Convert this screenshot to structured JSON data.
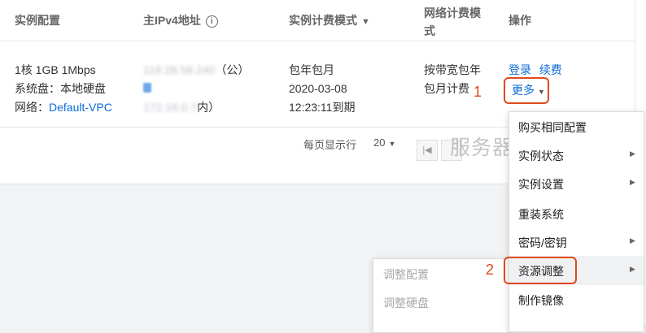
{
  "header": {
    "col_config": "实例配置",
    "col_ip": "主IPv4地址",
    "col_billing": "实例计费模式",
    "col_network_billing_1": "网络计费模",
    "col_network_billing_2": "式",
    "col_actions": "操作"
  },
  "row": {
    "config_line1": "1核 1GB 1Mbps",
    "config_line2": "系统盘：本地硬盘",
    "config_network_label": "网络：",
    "config_network_value": "Default-VPC",
    "ip_public_value": "119.28.58.240",
    "ip_public_suffix": "（公）",
    "ip_private_value": "172.16.0.7",
    "ip_private_suffix": "内）",
    "billing_mode": "包年包月",
    "billing_date": "2020-03-08",
    "billing_expire": "12:23:11到期",
    "network_billing_1": "按带宽包年",
    "network_billing_2": "包月计费",
    "action_login": "登录",
    "action_renew": "续费",
    "action_more": "更多"
  },
  "pager": {
    "per_page_label": "每页显示行",
    "per_page_value": "20"
  },
  "watermark": "服务器百科",
  "marks": {
    "mark1": "1",
    "mark2": "2"
  },
  "menu": {
    "items": [
      {
        "label": "购买相同配置",
        "submenu": false
      },
      {
        "label": "实例状态",
        "submenu": true
      },
      {
        "label": "实例设置",
        "submenu": true
      },
      {
        "label": "重装系统",
        "submenu": false
      },
      {
        "label": "密码/密钥",
        "submenu": true
      },
      {
        "label": "资源调整",
        "submenu": true
      },
      {
        "label": "制作镜像",
        "submenu": false
      }
    ]
  },
  "submenu": {
    "items": [
      "调整配置",
      "调整硬盘"
    ]
  },
  "colors": {
    "link": "#0a6cd6",
    "highlight": "#e04a1c"
  }
}
